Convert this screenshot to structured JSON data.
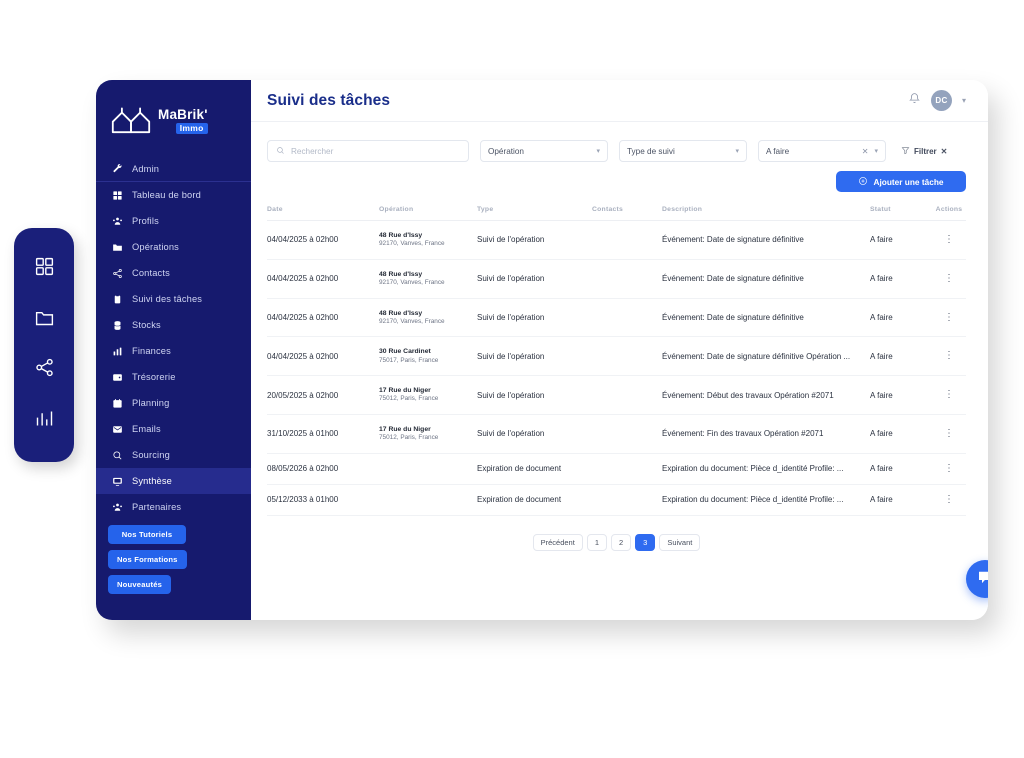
{
  "rail": {
    "items": [
      {
        "icon": "grid-icon",
        "name": "rail-item-dashboard"
      },
      {
        "icon": "folder-icon",
        "name": "rail-item-folder"
      },
      {
        "icon": "share-icon",
        "name": "rail-item-network"
      },
      {
        "icon": "bar-chart-icon",
        "name": "rail-item-stats"
      }
    ]
  },
  "sidebar": {
    "logo": {
      "text": "MaBrik'",
      "badge": "Immo"
    },
    "items": [
      {
        "label": "Admin",
        "icon": "wrench-icon",
        "active": false
      },
      {
        "label": "Tableau de bord",
        "icon": "grid-icon",
        "active": false
      },
      {
        "label": "Profils",
        "icon": "users-icon",
        "active": false
      },
      {
        "label": "Opérations",
        "icon": "folder-icon",
        "active": false
      },
      {
        "label": "Contacts",
        "icon": "share-icon",
        "active": false
      },
      {
        "label": "Suivi des tâches",
        "icon": "clipboard-icon",
        "active": false
      },
      {
        "label": "Stocks",
        "icon": "database-icon",
        "active": false
      },
      {
        "label": "Finances",
        "icon": "bar-chart-icon",
        "active": false
      },
      {
        "label": "Trésorerie",
        "icon": "wallet-icon",
        "active": false
      },
      {
        "label": "Planning",
        "icon": "calendar-icon",
        "active": false
      },
      {
        "label": "Emails",
        "icon": "mail-icon",
        "active": false
      },
      {
        "label": "Sourcing",
        "icon": "search-icon",
        "active": false
      },
      {
        "label": "Synthèse",
        "icon": "monitor-icon",
        "active": true
      },
      {
        "label": "Partenaires",
        "icon": "users-icon",
        "active": false
      }
    ],
    "buttons": {
      "tutoriels": "Nos Tutoriels",
      "formations": "Nos Formations",
      "nouveautes": "Nouveautés"
    }
  },
  "header": {
    "title": "Suivi des tâches",
    "avatar_initials": "DC"
  },
  "filters": {
    "search_placeholder": "Rechercher",
    "search_value": "",
    "operation_label": "Opération",
    "type_label": "Type de suivi",
    "statut_label": "A faire",
    "filter_label": "Filtrer",
    "clear_glyph": "✕",
    "chevron_glyph": "▾"
  },
  "actions": {
    "add_task": "Ajouter une tâche"
  },
  "table": {
    "columns": [
      "Date",
      "Opération",
      "Type",
      "Contacts",
      "Description",
      "Statut",
      "Actions"
    ],
    "rows": [
      {
        "date": "04/04/2025 à 02h00",
        "op_line1": "48 Rue d'Issy",
        "op_line2": "92170, Vanves, France",
        "type": "Suivi de l'opération",
        "contacts": "",
        "description": "Événement: Date de signature définitive",
        "statut": "A faire"
      },
      {
        "date": "04/04/2025 à 02h00",
        "op_line1": "48 Rue d'Issy",
        "op_line2": "92170, Vanves, France",
        "type": "Suivi de l'opération",
        "contacts": "",
        "description": "Événement: Date de signature définitive",
        "statut": "A faire"
      },
      {
        "date": "04/04/2025 à 02h00",
        "op_line1": "48 Rue d'Issy",
        "op_line2": "92170, Vanves, France",
        "type": "Suivi de l'opération",
        "contacts": "",
        "description": "Événement: Date de signature définitive",
        "statut": "A faire"
      },
      {
        "date": "04/04/2025 à 02h00",
        "op_line1": "30 Rue Cardinet",
        "op_line2": "75017, Paris, France",
        "type": "Suivi de l'opération",
        "contacts": "",
        "description": "Événement: Date de signature définitive Opération ...",
        "statut": "A faire"
      },
      {
        "date": "20/05/2025 à 02h00",
        "op_line1": "17 Rue du Niger",
        "op_line2": "75012, Paris, France",
        "type": "Suivi de l'opération",
        "contacts": "",
        "description": "Événement: Début des travaux Opération #2071",
        "statut": "A faire"
      },
      {
        "date": "31/10/2025 à 01h00",
        "op_line1": "17 Rue du Niger",
        "op_line2": "75012, Paris, France",
        "type": "Suivi de l'opération",
        "contacts": "",
        "description": "Événement: Fin des travaux Opération #2071",
        "statut": "A faire"
      },
      {
        "date": "08/05/2026 à 02h00",
        "op_line1": "",
        "op_line2": "",
        "type": "Expiration de document",
        "contacts": "",
        "description": "Expiration du document: Pièce d_identité Profile: ...",
        "statut": "A faire"
      },
      {
        "date": "05/12/2033 à 01h00",
        "op_line1": "",
        "op_line2": "",
        "type": "Expiration de document",
        "contacts": "",
        "description": "Expiration du document: Pièce d_identité Profile: ...",
        "statut": "A faire"
      }
    ],
    "row_action_glyph": "⋮"
  },
  "pagination": {
    "prev": "Précédent",
    "pages": [
      "1",
      "2",
      "3"
    ],
    "active_page": "3",
    "next": "Suivant"
  },
  "colors": {
    "sidebar_bg": "#161a6e",
    "sidebar_active": "#262c8e",
    "rail_bg": "#1a1f7a",
    "accent_blue": "#2f6bf0",
    "title_blue": "#1a2e8a",
    "badge_blue": "#2563eb"
  }
}
